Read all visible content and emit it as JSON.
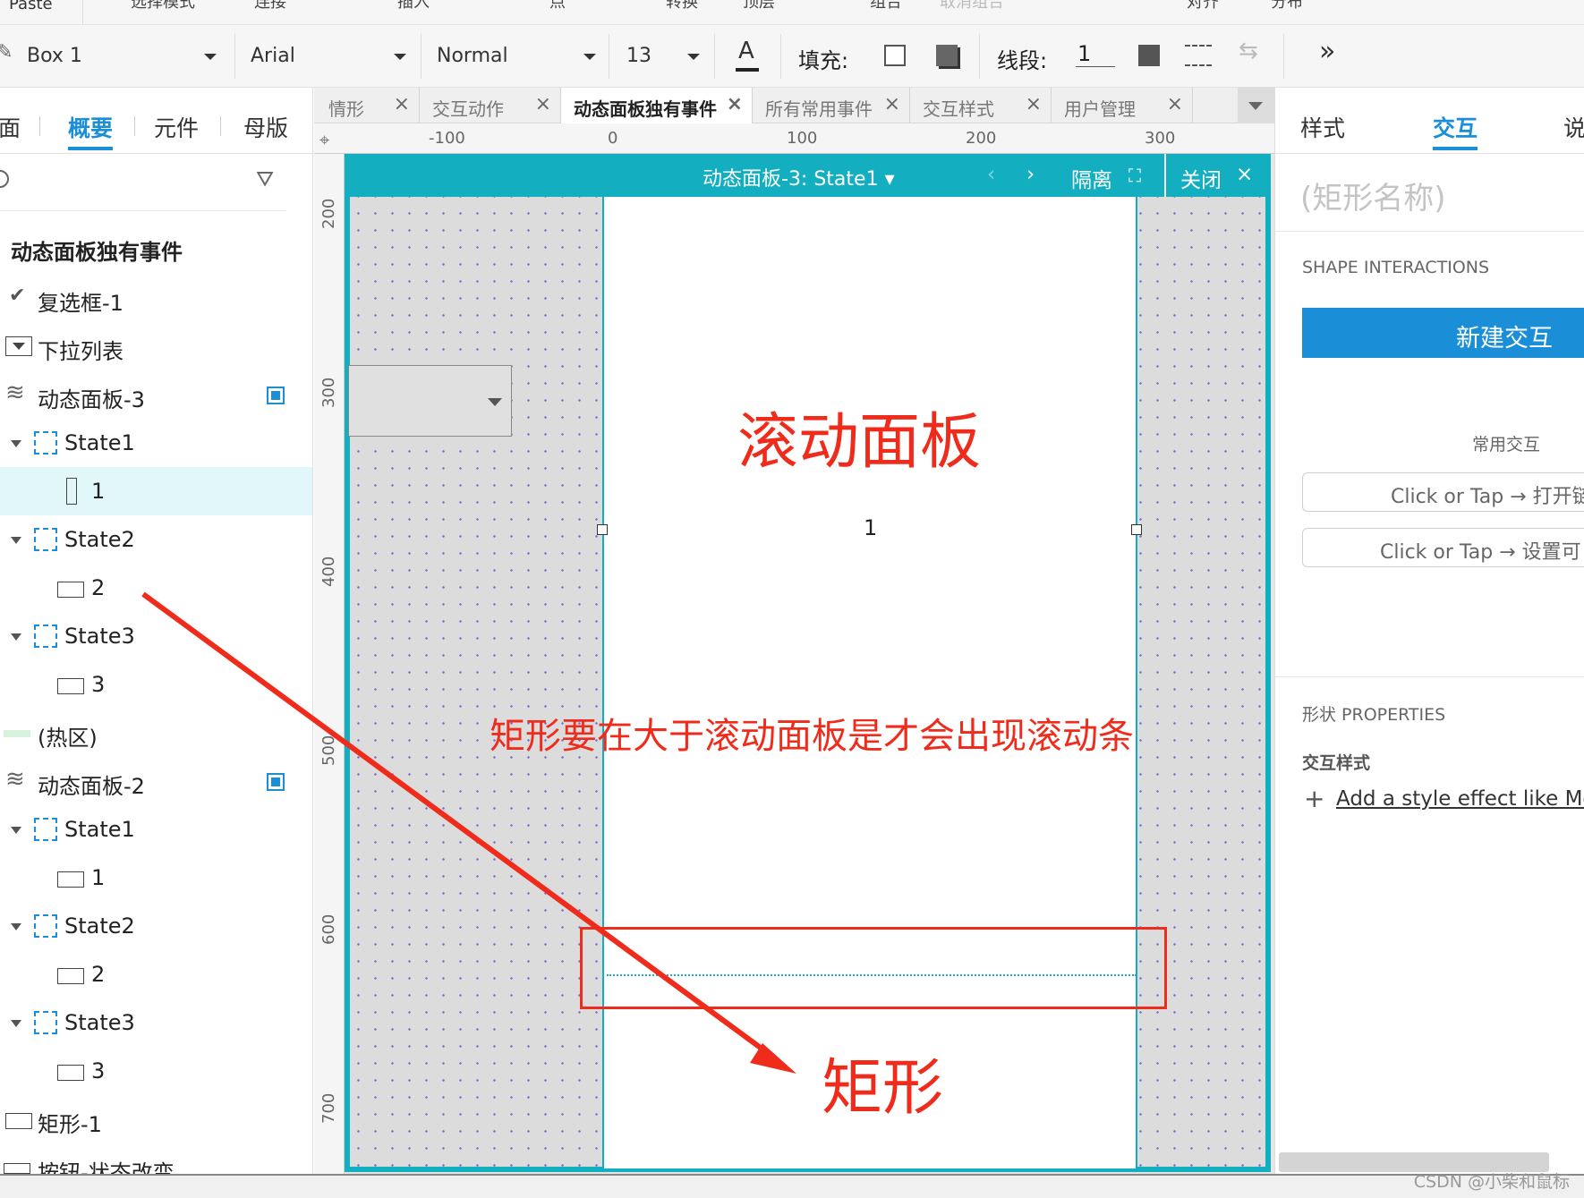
{
  "menubar": {
    "paste": "Paste",
    "cut_items": [
      "选择模式",
      "连接",
      "插入",
      "点",
      "转换",
      "顶层",
      "组合",
      "取消组合",
      "对齐",
      "分布"
    ]
  },
  "toolbar": {
    "style_select": "Box 1",
    "font_select": "Arial",
    "weight_select": "Normal",
    "size_select": "13",
    "fill_label": "填充:",
    "line_label": "线段:",
    "line_value": "1",
    "more_icon": "double-chevron-right"
  },
  "left_panel": {
    "tabs": [
      "面",
      "概要",
      "元件",
      "母版"
    ],
    "active_tab": "概要",
    "tree_title": "动态面板独有事件",
    "items": [
      {
        "label": "复选框-1"
      },
      {
        "label": "下拉列表"
      },
      {
        "label": "动态面板-3"
      },
      {
        "label": "State1"
      },
      {
        "label": "1"
      },
      {
        "label": "State2"
      },
      {
        "label": "2"
      },
      {
        "label": "State3"
      },
      {
        "label": "3"
      },
      {
        "label": "(热区)"
      },
      {
        "label": "动态面板-2"
      },
      {
        "label": "State1"
      },
      {
        "label": "1"
      },
      {
        "label": "State2"
      },
      {
        "label": "2"
      },
      {
        "label": "State3"
      },
      {
        "label": "3"
      },
      {
        "label": "矩形-1"
      },
      {
        "label": "按钮-状态改变"
      }
    ]
  },
  "doc_tabs": [
    "情形",
    "交互动作",
    "动态面板独有事件",
    "所有常用事件",
    "交互样式",
    "用户管理"
  ],
  "active_doc_tab": "动态面板独有事件",
  "ruler": {
    "top": [
      "-100",
      "0",
      "100",
      "200",
      "300"
    ],
    "left": [
      "200",
      "300",
      "400",
      "500",
      "600",
      "700"
    ]
  },
  "panel_header": {
    "title": "动态面板-3: State1",
    "isolate": "隔离",
    "close": "关闭"
  },
  "canvas": {
    "rect_label": "1",
    "annotation_title": "滚动面板",
    "annotation_note": "矩形要在大于滚动面板是才会出现滚动条",
    "annotation_arrow_label": "矩形"
  },
  "right_panel": {
    "tabs": [
      "样式",
      "交互",
      "说"
    ],
    "active_tab": "交互",
    "name_placeholder": "(矩形名称)",
    "shape_interactions": "SHAPE INTERACTIONS",
    "new_interaction": "新建交互",
    "common_heading": "常用交互",
    "common_items": [
      "Click or Tap → 打开链",
      "Click or Tap → 设置可"
    ],
    "properties_heading": "形状 PROPERTIES",
    "style_heading": "交互样式",
    "add_style": "Add a style effect like Mou"
  },
  "watermark": "CSDN @小柴和鼠标",
  "colors": {
    "accent": "#1a8fd8",
    "panel_teal": "#13afc0",
    "annotation_red": "#ef2b1b"
  }
}
